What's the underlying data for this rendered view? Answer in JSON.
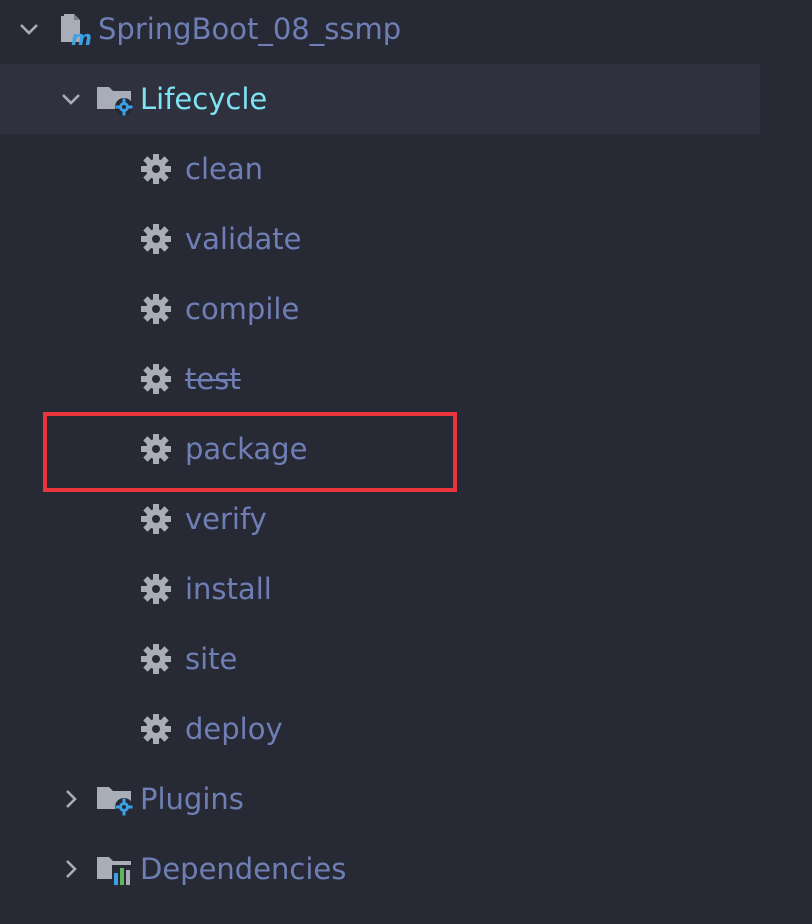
{
  "tree": {
    "project": {
      "label": "SpringBoot_08_ssmp",
      "icon": "maven-project-icon",
      "expanded": true
    },
    "lifecycle": {
      "label": "Lifecycle",
      "icon": "folder-gear-icon",
      "expanded": true,
      "selected": true,
      "goals": [
        {
          "label": "clean",
          "icon": "gear-icon",
          "strikethrough": false
        },
        {
          "label": "validate",
          "icon": "gear-icon",
          "strikethrough": false
        },
        {
          "label": "compile",
          "icon": "gear-icon",
          "strikethrough": false
        },
        {
          "label": "test",
          "icon": "gear-icon",
          "strikethrough": true
        },
        {
          "label": "package",
          "icon": "gear-icon",
          "strikethrough": false,
          "highlighted": true
        },
        {
          "label": "verify",
          "icon": "gear-icon",
          "strikethrough": false
        },
        {
          "label": "install",
          "icon": "gear-icon",
          "strikethrough": false
        },
        {
          "label": "site",
          "icon": "gear-icon",
          "strikethrough": false
        },
        {
          "label": "deploy",
          "icon": "gear-icon",
          "strikethrough": false
        }
      ]
    },
    "plugins": {
      "label": "Plugins",
      "icon": "folder-gear-icon",
      "expanded": false
    },
    "dependencies": {
      "label": "Dependencies",
      "icon": "folder-library-icon",
      "expanded": false
    }
  },
  "colors": {
    "background": "#272a35",
    "selected_row": "#2f323e",
    "text": "#6f7fb5",
    "selected_text": "#7ee3f2",
    "icon_gray": "#a9adb8",
    "icon_blue": "#3ba0e6",
    "highlight": "#e8353b"
  }
}
